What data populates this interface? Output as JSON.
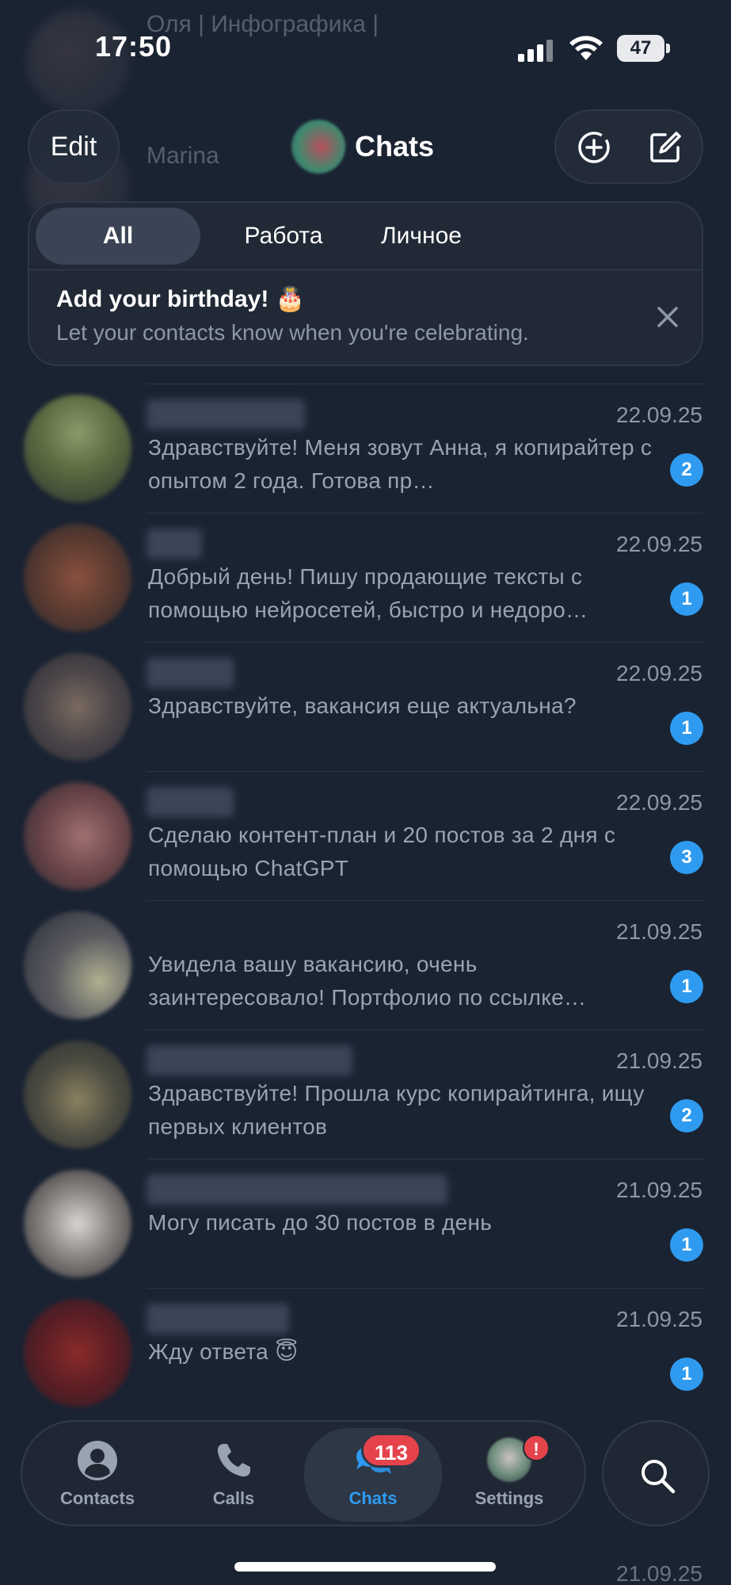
{
  "status_bar": {
    "time": "17:50",
    "battery": "47"
  },
  "header": {
    "edit_label": "Edit",
    "title": "Chats",
    "new_story_icon": "circle-plus-icon",
    "compose_icon": "compose-icon"
  },
  "folders": {
    "tabs": [
      {
        "label": "All",
        "active": true
      },
      {
        "label": "Работа",
        "active": false
      },
      {
        "label": "Личное",
        "active": false
      }
    ]
  },
  "birthday_banner": {
    "title": "Add your birthday! 🎂",
    "subtitle": "Let your contacts know when you're celebrating."
  },
  "background_chats": [
    {
      "name": "Оля | Инфографика |"
    },
    {
      "name": "Marina"
    }
  ],
  "chats": [
    {
      "date": "22.09.25",
      "message": "Здравствуйте! Меня зовут Анна, я копирайтер с опытом 2 года. Готова пр…",
      "unread": "2"
    },
    {
      "date": "22.09.25",
      "message": "Добрый день! Пишу продающие тексты с помощью нейросетей, быстро и недоро…",
      "unread": "1"
    },
    {
      "date": "22.09.25",
      "message": "Здравствуйте, вакансия еще актуальна?",
      "unread": "1"
    },
    {
      "date": "22.09.25",
      "message": "Сделаю контент-план и 20 постов за 2 дня с помощью ChatGPT",
      "unread": "3"
    },
    {
      "date": "21.09.25",
      "message": "Увидела вашу вакансию, очень заинтересовало! Портфолио по ссылке…",
      "unread": "1"
    },
    {
      "date": "21.09.25",
      "message": "Здравствуйте! Прошла курс копирайтинга, ищу первых клиентов",
      "unread": "2"
    },
    {
      "date": "21.09.25",
      "message": "Могу писать до 30 постов в день",
      "unread": "1"
    },
    {
      "date": "21.09.25",
      "message": "Жду ответа 😇",
      "unread": "1"
    }
  ],
  "partial_bottom_chat": {
    "date": "21.09.25"
  },
  "tab_bar": {
    "contacts_label": "Contacts",
    "calls_label": "Calls",
    "chats_label": "Chats",
    "chats_count": "113",
    "settings_label": "Settings",
    "settings_alert": "!",
    "active": "Chats"
  },
  "colors": {
    "background": "#1a2332",
    "accent": "#2f9bf0",
    "badge_red": "#e5434b",
    "secondary_text": "#8e97a6"
  }
}
